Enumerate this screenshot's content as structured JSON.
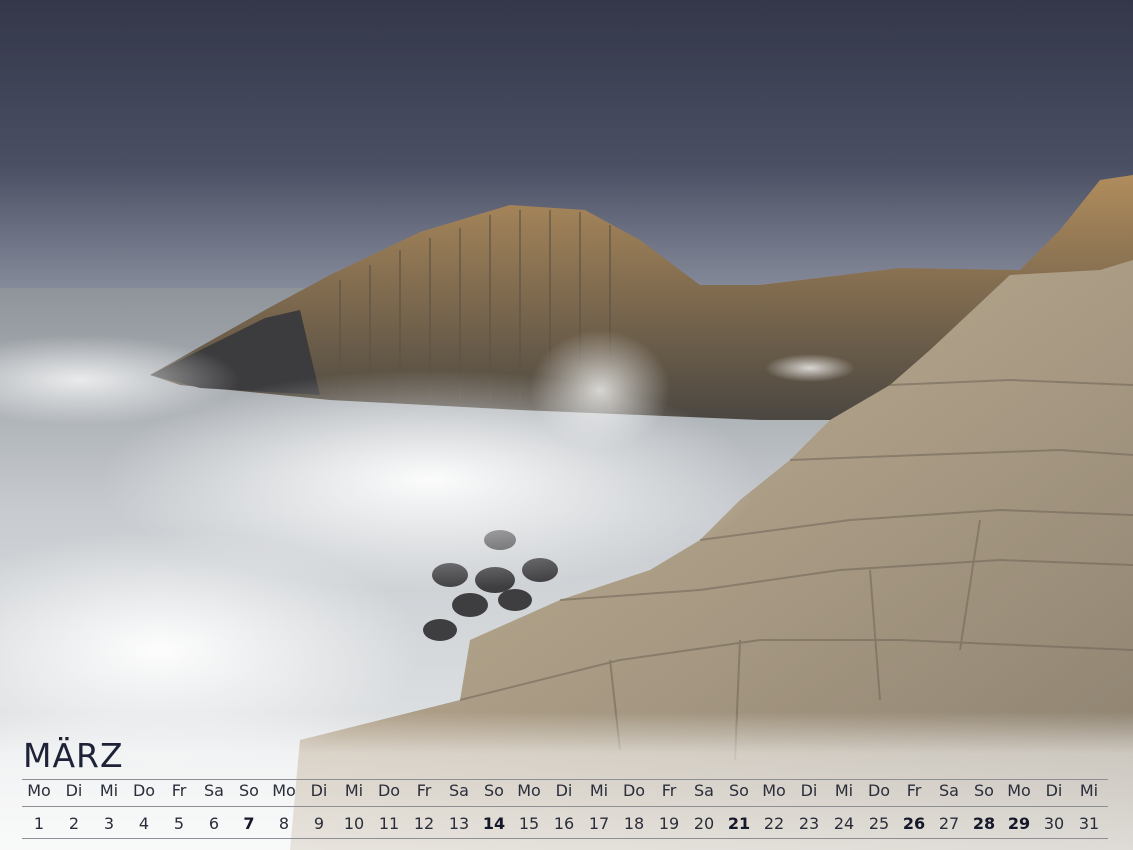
{
  "calendar": {
    "month": "MÄRZ",
    "weekdays": [
      "Mo",
      "Di",
      "Mi",
      "Do",
      "Fr",
      "Sa",
      "So",
      "Mo",
      "Di",
      "Mi",
      "Do",
      "Fr",
      "Sa",
      "So",
      "Mo",
      "Di",
      "Mi",
      "Do",
      "Fr",
      "Sa",
      "So",
      "Mo",
      "Di",
      "Mi",
      "Do",
      "Fr",
      "Sa",
      "So",
      "Mo",
      "Di",
      "Mi"
    ],
    "dates": [
      "1",
      "2",
      "3",
      "4",
      "5",
      "6",
      "7",
      "8",
      "9",
      "10",
      "11",
      "12",
      "13",
      "14",
      "15",
      "16",
      "17",
      "18",
      "19",
      "20",
      "21",
      "22",
      "23",
      "24",
      "25",
      "26",
      "27",
      "28",
      "29",
      "30",
      "31"
    ],
    "highlighted": [
      "7",
      "14",
      "21",
      "26",
      "28",
      "29"
    ]
  },
  "colors": {
    "text": "#1e2236",
    "sky": "#3f4354",
    "sea": "#c9ccd0",
    "rock": "#a89a86"
  }
}
